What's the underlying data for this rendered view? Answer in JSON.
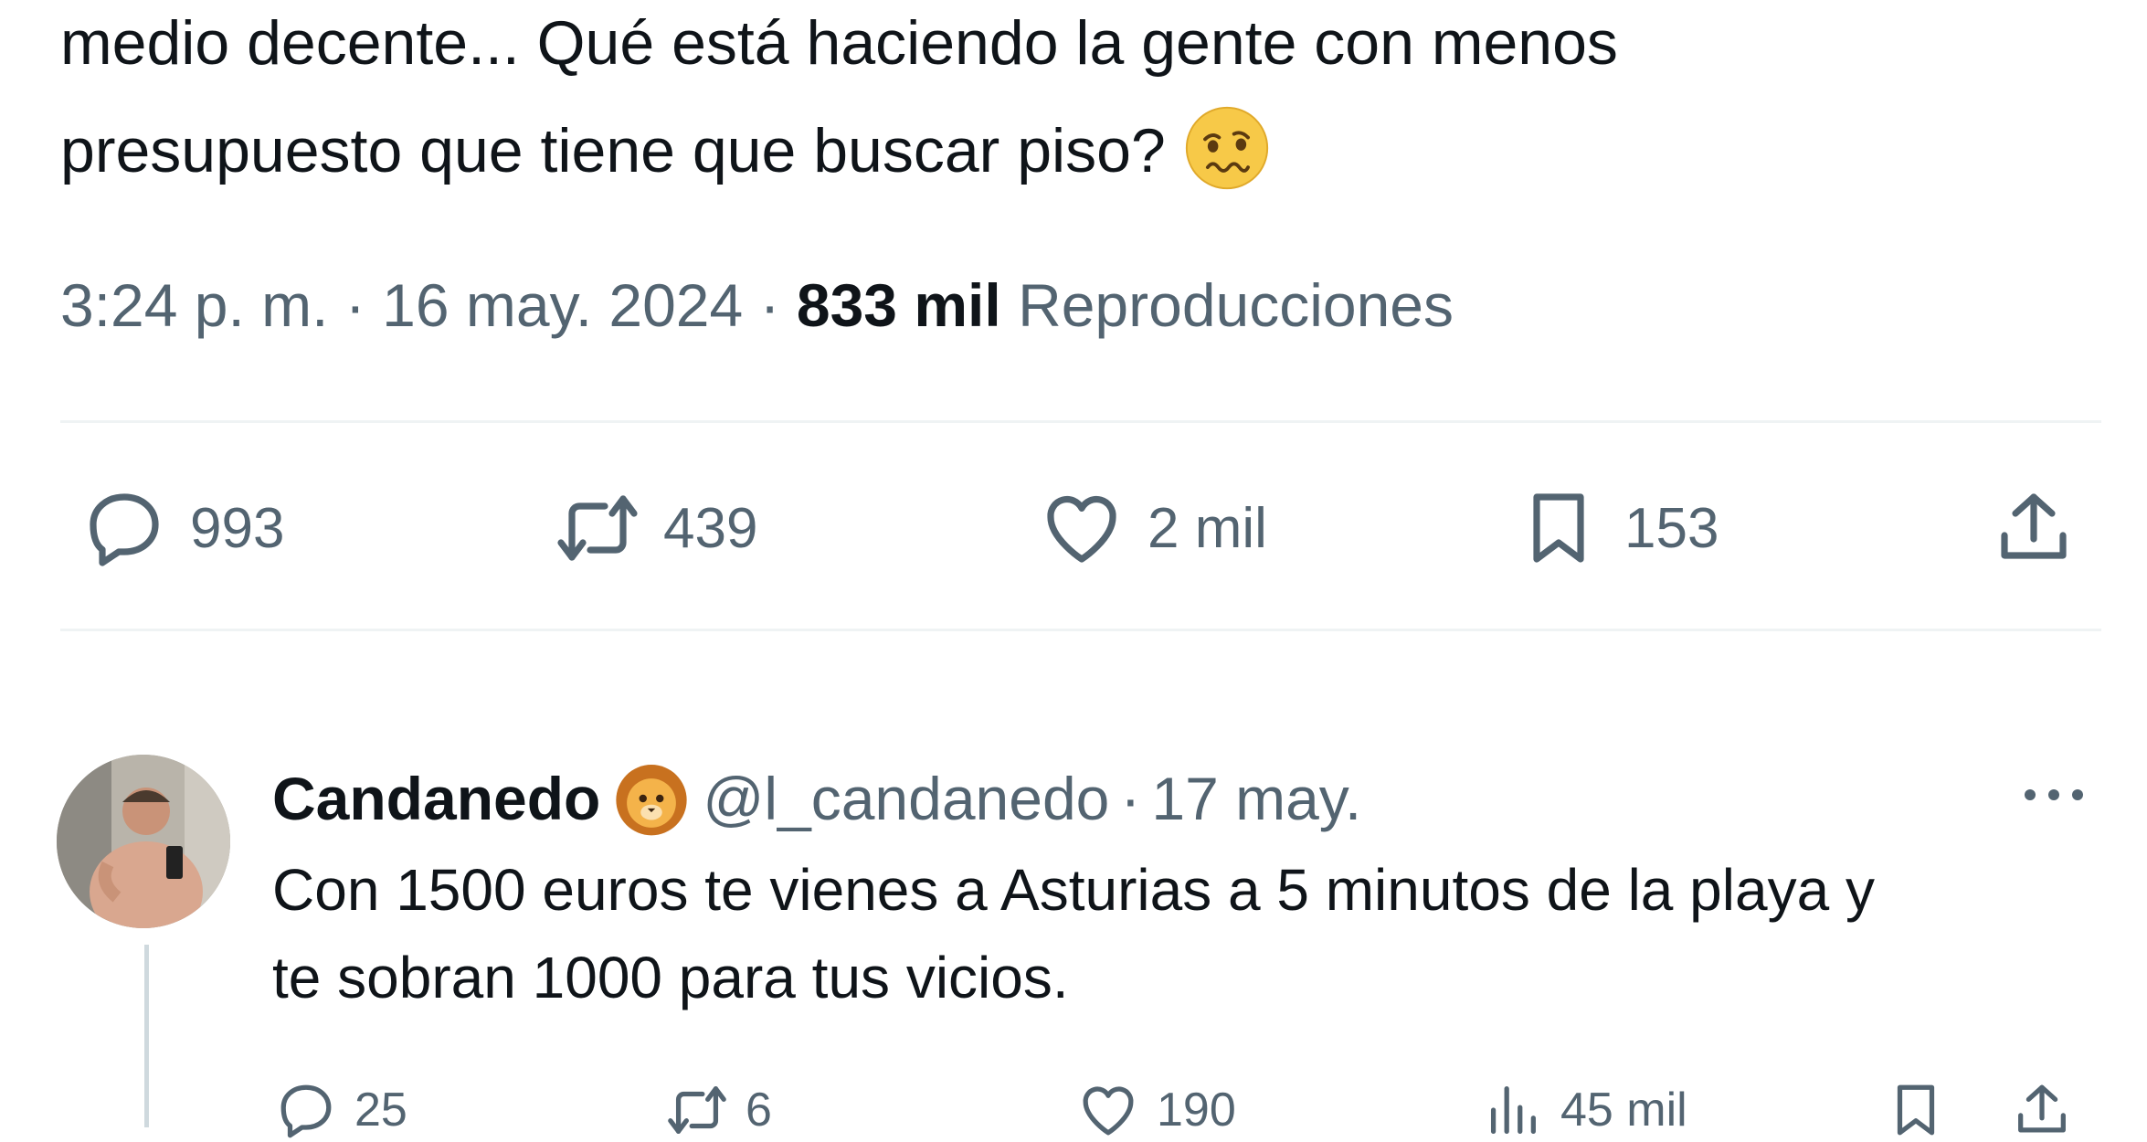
{
  "tweet": {
    "text_line1": "medio decente... Qué está haciendo la gente con menos",
    "text_line2": "presupuesto que tiene que buscar piso?",
    "emoji": "woozy-face-emoji",
    "time": "3:24 p. m.",
    "date": "16 may. 2024",
    "separator": "·",
    "views_count": "833 mil",
    "views_label": "Reproducciones",
    "actions": {
      "replies": "993",
      "retweets": "439",
      "likes": "2 mil",
      "bookmarks": "153"
    }
  },
  "reply": {
    "name": "Candanedo",
    "badge_emoji": "lion-face-emoji",
    "handle": "@l_candanedo",
    "separator": "·",
    "date": "17 may.",
    "text_line1": "Con 1500 euros te vienes a Asturias a 5 minutos de la playa y",
    "text_line2": "te sobran 1000 para tus vicios.",
    "actions": {
      "replies": "25",
      "retweets": "6",
      "likes": "190",
      "views": "45 mil"
    }
  },
  "colors": {
    "text": "#0f1419",
    "muted": "#536471",
    "divider": "#eff3f4",
    "thread_line": "#cfd9de"
  }
}
